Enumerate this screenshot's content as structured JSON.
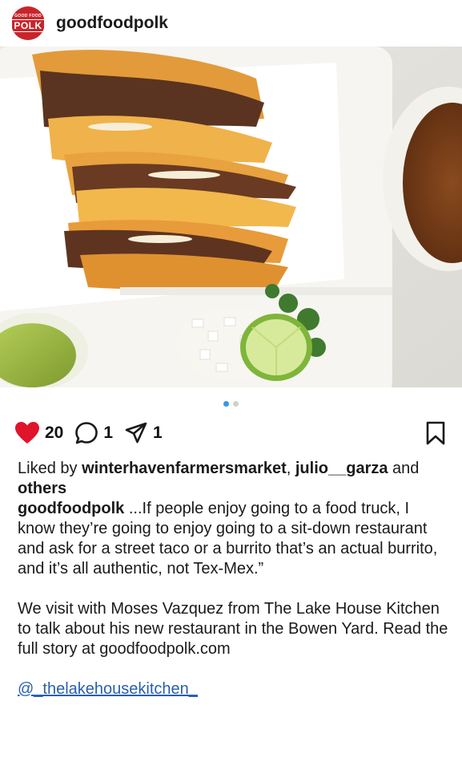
{
  "header": {
    "avatar_small": "GOOD FOOD",
    "avatar_big": "POLK",
    "username": "goodfoodpolk"
  },
  "carousel": {
    "count": 2,
    "active_index": 0
  },
  "actions": {
    "likes": "20",
    "comments": "1",
    "shares": "1"
  },
  "likes_line": {
    "prefix": "Liked by ",
    "user1": "winterhavenfarmersmarket",
    "sep": ", ",
    "user2": "julio__garza",
    "and": " and ",
    "others": "others"
  },
  "caption": {
    "author": "goodfoodpolk",
    "text1": " ...If people enjoy going to a food truck, I know they’re going to enjoy going to a sit-down restaurant and ask for a street taco or a burrito that’s an actual burrito, and it’s all authentic, not Tex-Mex.”",
    "text2": "We visit with Moses Vazquez from The Lake House Kitchen to talk about his new restaurant in the Bowen Yard. Read the full story at goodfoodpolk.com",
    "mention": "@_thelakehousekitchen_"
  },
  "colors": {
    "heart": "#e0142a",
    "brand": "#c8242b",
    "dot_active": "#3897f0",
    "mention": "#2a5fae"
  },
  "icons": [
    "heart-icon",
    "comment-icon",
    "share-icon",
    "bookmark-icon"
  ]
}
